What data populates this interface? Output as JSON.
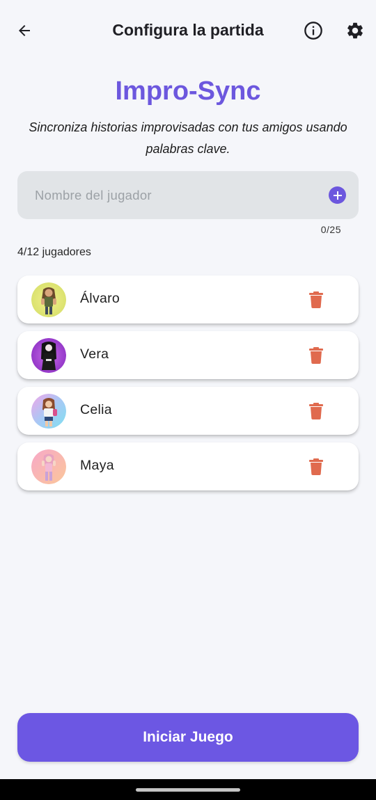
{
  "appbar": {
    "title": "Configura la partida",
    "back_icon": "arrow-left-icon",
    "info_icon": "info-circle-icon",
    "settings_icon": "gear-icon"
  },
  "hero": {
    "brand": "Impro-Sync",
    "tagline": "Sincroniza historias improvisadas con tus amigos usando palabras clave."
  },
  "input": {
    "placeholder": "Nombre del jugador",
    "value": "",
    "counter": "0/25",
    "add_icon": "plus-circle-icon"
  },
  "players": {
    "count_label": "4/12 jugadores",
    "items": [
      {
        "name": "Álvaro",
        "avatar": "avatar-alvaro"
      },
      {
        "name": "Vera",
        "avatar": "avatar-vera"
      },
      {
        "name": "Celia",
        "avatar": "avatar-celia"
      },
      {
        "name": "Maya",
        "avatar": "avatar-maya"
      }
    ],
    "delete_icon": "trash-icon"
  },
  "start_button": {
    "label": "Iniciar Juego"
  },
  "colors": {
    "accent": "#6c57de",
    "delete": "#e06a4e",
    "background": "#f5f6fa",
    "input_bg": "#e1e4e7"
  }
}
